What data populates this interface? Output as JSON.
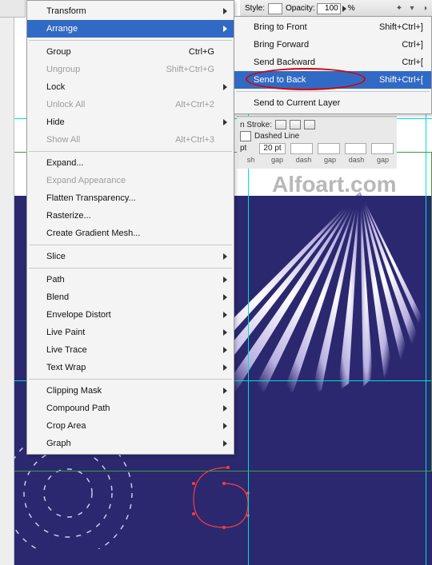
{
  "watermark": "Alfoart.com",
  "toolbar": {
    "style_label": "Style:",
    "opacity_label": "Opacity:",
    "opacity_value": "100",
    "percent": "%"
  },
  "stroke": {
    "align_label": "n Stroke:",
    "dashed_label": "Dashed Line",
    "dash_unit": "pt",
    "dash_val": "20 pt",
    "col_labels": [
      "sh",
      "gap",
      "dash",
      "gap",
      "dash",
      "gap"
    ]
  },
  "menu": {
    "items": [
      {
        "label": "Transform",
        "arrow": true
      },
      {
        "label": "Arrange",
        "arrow": true,
        "highlight": true
      },
      {
        "sep": true
      },
      {
        "label": "Group",
        "shortcut": "Ctrl+G"
      },
      {
        "label": "Ungroup",
        "shortcut": "Shift+Ctrl+G",
        "disabled": true
      },
      {
        "label": "Lock",
        "arrow": true
      },
      {
        "label": "Unlock All",
        "shortcut": "Alt+Ctrl+2",
        "disabled": true
      },
      {
        "label": "Hide",
        "arrow": true
      },
      {
        "label": "Show All",
        "shortcut": "Alt+Ctrl+3",
        "disabled": true
      },
      {
        "sep": true
      },
      {
        "label": "Expand..."
      },
      {
        "label": "Expand Appearance",
        "disabled": true
      },
      {
        "label": "Flatten Transparency..."
      },
      {
        "label": "Rasterize..."
      },
      {
        "label": "Create Gradient Mesh..."
      },
      {
        "sep": true
      },
      {
        "label": "Slice",
        "arrow": true
      },
      {
        "sep": true
      },
      {
        "label": "Path",
        "arrow": true
      },
      {
        "label": "Blend",
        "arrow": true
      },
      {
        "label": "Envelope Distort",
        "arrow": true
      },
      {
        "label": "Live Paint",
        "arrow": true
      },
      {
        "label": "Live Trace",
        "arrow": true
      },
      {
        "label": "Text Wrap",
        "arrow": true
      },
      {
        "sep": true
      },
      {
        "label": "Clipping Mask",
        "arrow": true
      },
      {
        "label": "Compound Path",
        "arrow": true
      },
      {
        "label": "Crop Area",
        "arrow": true
      },
      {
        "label": "Graph",
        "arrow": true
      }
    ]
  },
  "submenu": {
    "items": [
      {
        "label": "Bring to Front",
        "shortcut": "Shift+Ctrl+]"
      },
      {
        "label": "Bring Forward",
        "shortcut": "Ctrl+]"
      },
      {
        "label": "Send Backward",
        "shortcut": "Ctrl+["
      },
      {
        "label": "Send to Back",
        "shortcut": "Shift+Ctrl+[",
        "highlight": true
      },
      {
        "sep": true
      },
      {
        "label": "Send to Current Layer"
      }
    ]
  }
}
